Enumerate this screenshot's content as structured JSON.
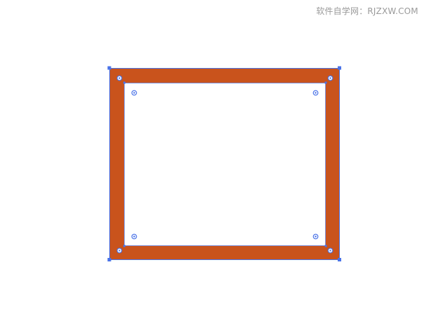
{
  "watermark": {
    "text": "软件自学网：RJZXW.COM"
  },
  "artwork": {
    "frame_color": "#C9531C",
    "inner_fill": "#FFFFFF",
    "selection_color": "#4A73E8",
    "inner_path_color": "#7C8FD8",
    "icon_names": [
      "corner-widget-icon",
      "anchor-point-icon"
    ]
  }
}
